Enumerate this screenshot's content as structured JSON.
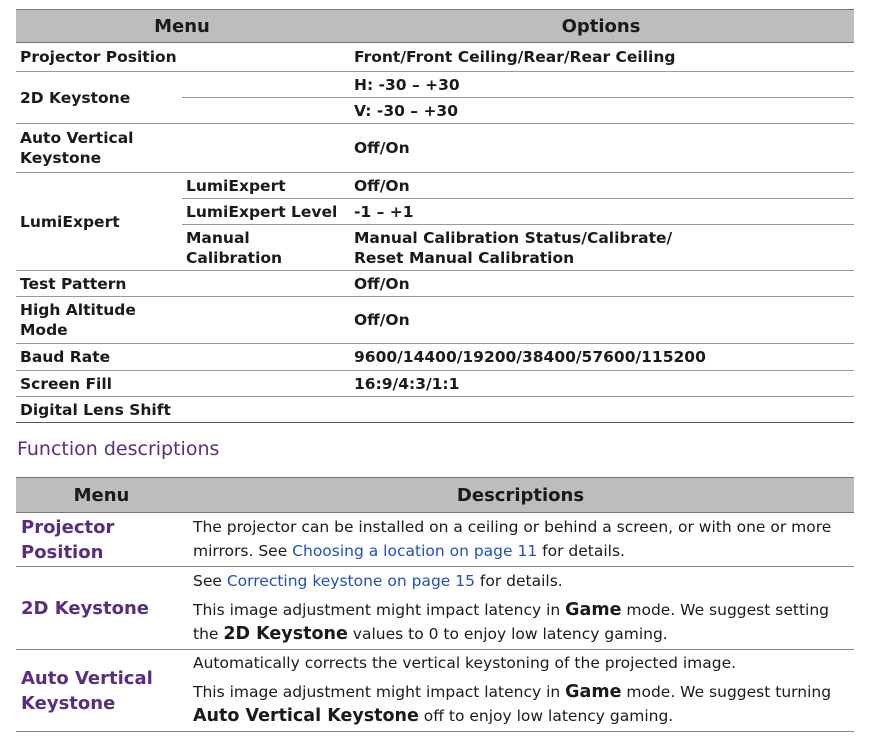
{
  "options_table": {
    "headers": {
      "menu": "Menu",
      "options": "Options"
    },
    "rows": {
      "projector_position": {
        "menu": "Projector Position",
        "options": "Front/Front Ceiling/Rear/Rear Ceiling"
      },
      "keystone_2d": {
        "menu": "2D Keystone",
        "option_h": "H: -30 – +30",
        "option_v": "V: -30 – +30"
      },
      "auto_vertical_keystone": {
        "menu_line1": "Auto Vertical",
        "menu_line2": "Keystone",
        "options": "Off/On"
      },
      "lumiexpert": {
        "menu": "LumiExpert",
        "sub": [
          {
            "label": "LumiExpert",
            "options": "Off/On"
          },
          {
            "label": "LumiExpert Level",
            "options": "-1 – +1"
          },
          {
            "label_line1": "Manual",
            "label_line2": "Calibration",
            "options_line1": "Manual Calibration Status/Calibrate/",
            "options_line2": "Reset Manual Calibration"
          }
        ]
      },
      "test_pattern": {
        "menu": "Test Pattern",
        "options": "Off/On"
      },
      "high_altitude_mode": {
        "menu_line1": "High Altitude",
        "menu_line2": "Mode",
        "options": "Off/On"
      },
      "baud_rate": {
        "menu": "Baud Rate",
        "options": "9600/14400/19200/38400/57600/115200"
      },
      "screen_fill": {
        "menu": "Screen Fill",
        "options": "16:9/4:3/1:1"
      },
      "digital_lens_shift": {
        "menu": "Digital Lens Shift",
        "options": ""
      }
    }
  },
  "function_descriptions": {
    "title": "Function descriptions",
    "headers": {
      "menu": "Menu",
      "descriptions": "Descriptions"
    },
    "projector_position": {
      "menu_line1": "Projector",
      "menu_line2": "Position",
      "text1": "The projector can be installed on a ceiling or behind a screen, or with one or more mirrors. See ",
      "link": "Choosing a location on page 11",
      "text2": " for details."
    },
    "keystone_2d": {
      "menu": "2D Keystone",
      "p1_text1": "See ",
      "p1_link": "Correcting keystone on page 15",
      "p1_text2": " for details.",
      "p2_text1": "This image adjustment might impact latency in ",
      "p2_strong1": "Game",
      "p2_text2": " mode. We suggest setting the ",
      "p2_strong2": "2D Keystone",
      "p2_text3": " values to 0 to enjoy low latency gaming."
    },
    "auto_vertical_keystone": {
      "menu_line1": "Auto Vertical",
      "menu_line2": "Keystone",
      "p1": "Automatically corrects the vertical keystoning of the projected image.",
      "p2_text1": "This image adjustment might impact latency in ",
      "p2_strong1": "Game",
      "p2_text2": " mode. We suggest turning ",
      "p2_strong2": "Auto Vertical Keystone",
      "p2_text3": " off to enjoy low latency gaming."
    }
  },
  "colors": {
    "accent": "#5a2d82",
    "link": "#1f4fbf",
    "header_bg": "#bdbdbd"
  }
}
